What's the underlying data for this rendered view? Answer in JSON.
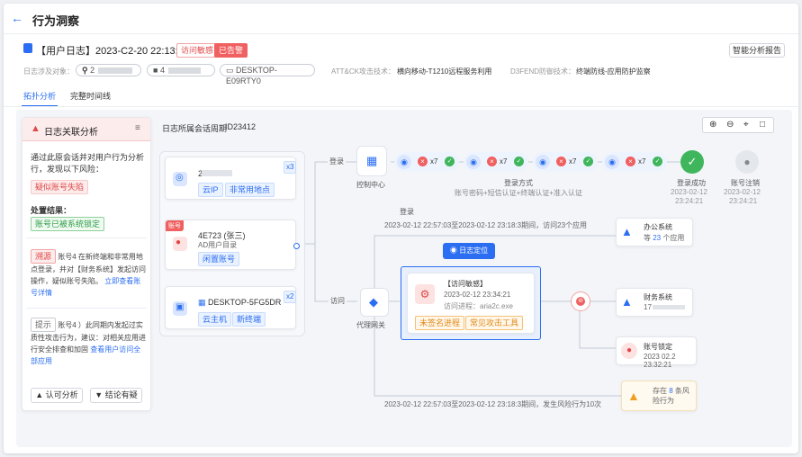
{
  "header": {
    "back_icon": "arrow-left-icon",
    "title": "行为洞察"
  },
  "log": {
    "title": "【用户日志】2023-C2-20 22:13:09",
    "tag1": "访问敏感",
    "tag2": "已告警",
    "report_button": "智能分析报告",
    "meta_label": "日志涉及对象：",
    "obj_ip": "2",
    "obj_user": "4",
    "obj_host": "DESKTOP-E09RTY0",
    "attack_label": "ATT&CK攻击技术：",
    "attack_value": "横向移动-T1210远程服务利用",
    "defend_label": "D3FEND防御技术：",
    "defend_value": "终端防线-应用防护监察"
  },
  "tabs": [
    "拓扑分析",
    "完整时间线"
  ],
  "left_panel": {
    "title": "日志关联分析",
    "desc": "通过此原会话并对用户行为分析行，发现以下风险：",
    "risk_tag": "疑似账号失陷",
    "action_label": "处置结果：",
    "action_tag": "账号已被系统锁定",
    "note1_tag": "溯源",
    "note1_text": "账号4 在新终端和非常用地点登录，并对【财务系统】发起访问操作，疑似账号失陷。",
    "note1_link": "立即查看账号详情",
    "note2_tag": "提示",
    "note2_text": "账号4 ）此同期内发起过实质性攻击行为，建议：对相关应用进行安全排查和加固",
    "note2_link": "查看用户访问全部应用",
    "btn_agree": "认可分析",
    "btn_disagree": "结论有疑"
  },
  "graph": {
    "title": "日志所属会话周期",
    "session_id": "ID23412",
    "ip_card": {
      "ip": "21.",
      "badge": "x3",
      "tag1": "云IP",
      "tag2": "非常用地点"
    },
    "user_card": {
      "corner": "账号",
      "name": "4E723 (张三)",
      "dir": "AD用户目录",
      "tag": "闲置账号"
    },
    "host_card": {
      "name": "DESKTOP-5FG5DR",
      "badge": "x2",
      "tag1": "云主机",
      "tag2": "新终端"
    },
    "edge_login": "登录",
    "edge_access": "访问",
    "auth_center": "控制中心",
    "proxy": "代理网关",
    "login_methods": "登录方式",
    "login_methods_desc": "账号密码+短信认证+终端认证+准入认证",
    "chips": [
      {
        "count": "x7"
      },
      {
        "count": "x7"
      },
      {
        "count": "x7"
      },
      {
        "count": "x7"
      }
    ],
    "login_ok": "登录成功",
    "login_ok_time": "2023-02-12",
    "login_ok_time2": "23:24:21",
    "logout": "账号注销",
    "logout_time": "2023-02-12",
    "logout_time2": "23:24:21",
    "login_label2": "登录",
    "range1": "2023-02-12 22:57:03至2023-02-12 23:18:3期间，访问23个应用",
    "office_sys": "办公系统",
    "office_count_pre": "等",
    "office_count": "23",
    "office_count_post": "个应用",
    "locate_btn": "日志定位",
    "focus": {
      "title": "【访问敏感】",
      "time": "2023-02-12 23:34:21",
      "proc": "访问进程：aria2c.exe",
      "tag1": "未签名进程",
      "tag2": "常见攻击工具"
    },
    "finance_sys": "财务系统",
    "finance_ip": "17",
    "lock": "账号锁定",
    "lock_time": "2023 02.2 23:32:21",
    "range2": "2023-02-12 22:57:03至2023-02-12 23:18:3期间，发生风险行为10次",
    "risk_pre": "存在",
    "risk_count": "8",
    "risk_post": "条风险行为"
  }
}
